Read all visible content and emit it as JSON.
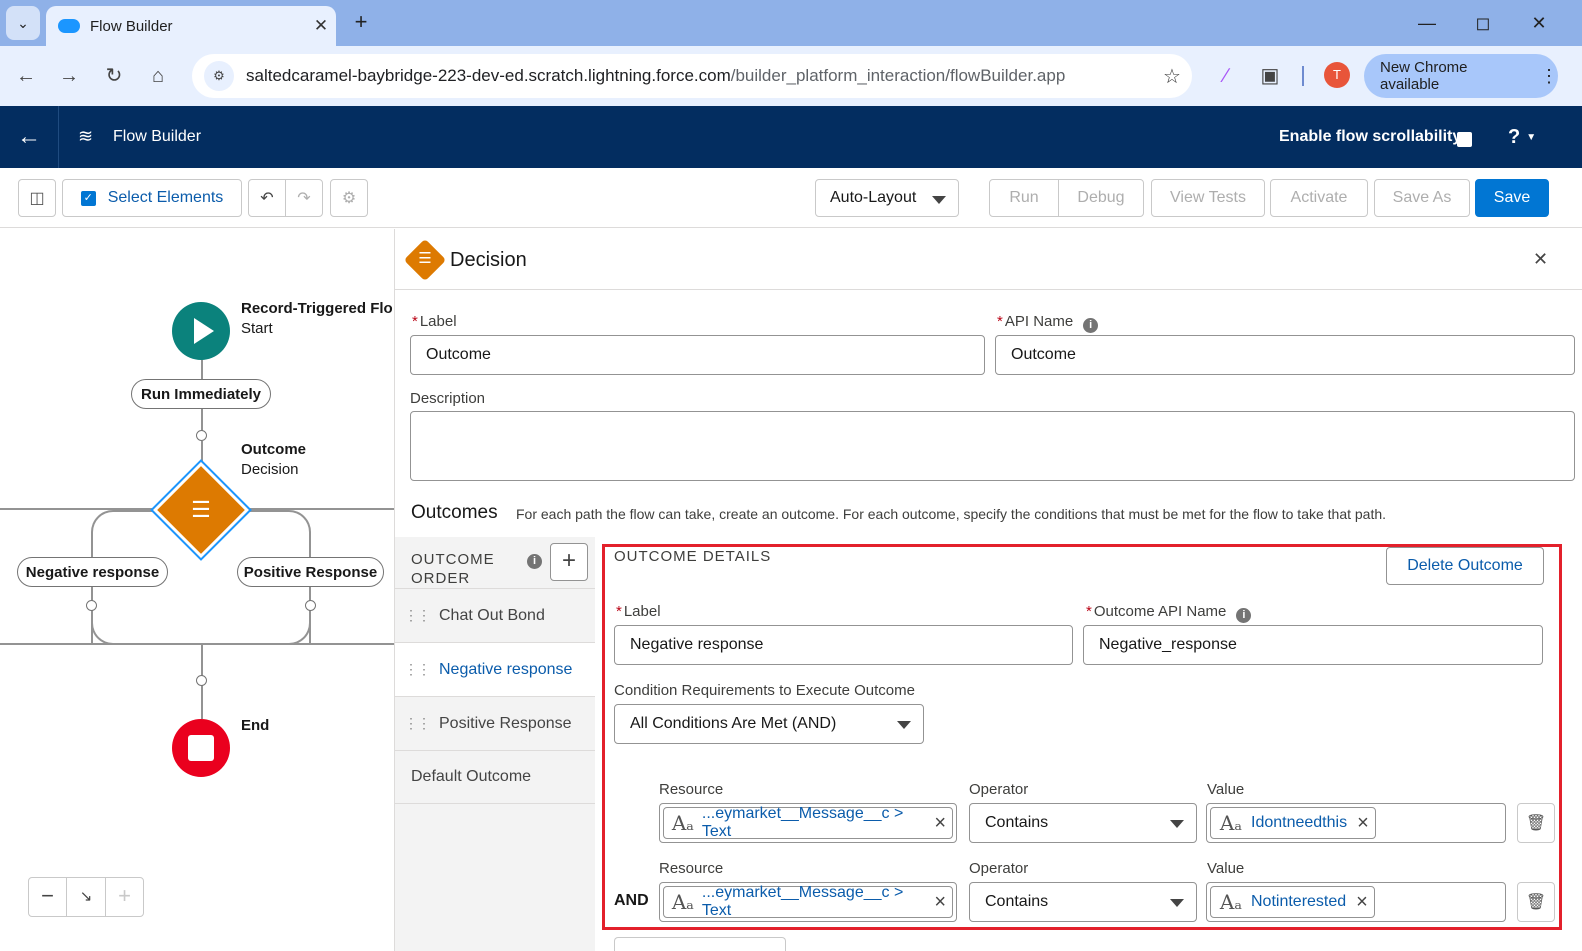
{
  "browser": {
    "tab_title": "Flow Builder",
    "url_host": "saltedcaramel-baybridge-223-dev-ed.scratch.lightning.force.com",
    "url_path": "/builder_platform_interaction/flowBuilder.app",
    "new_chrome": "New Chrome available",
    "avatar_letter": "T"
  },
  "header": {
    "app_title": "Flow Builder",
    "scroll_label": "Enable flow scrollability",
    "help": "?"
  },
  "toolbar": {
    "select_elements": "Select Elements",
    "layout": "Auto-Layout",
    "run": "Run",
    "debug": "Debug",
    "view_tests": "View Tests",
    "activate": "Activate",
    "save_as": "Save As",
    "save": "Save"
  },
  "canvas": {
    "start_title": "Record-Triggered Flo",
    "start_sub": "Start",
    "run_immediately": "Run Immediately",
    "decision_title": "Outcome",
    "decision_sub": "Decision",
    "branch_left": "Negative response",
    "branch_right": "Positive Response",
    "end_title": "End"
  },
  "panel": {
    "title": "Decision",
    "label_label": "Label",
    "label_value": "Outcome",
    "api_label": "API Name",
    "api_value": "Outcome",
    "description_label": "Description",
    "outcomes_title": "Outcomes",
    "outcomes_help": "For each path the flow can take, create an outcome. For each outcome, specify the conditions that must be met for the flow to take that path.",
    "order_title_1": "OUTCOME",
    "order_title_2": "ORDER",
    "order_items": [
      "Chat Out Bond",
      "Negative response",
      "Positive Response",
      "Default Outcome"
    ],
    "details_title": "OUTCOME DETAILS",
    "delete_outcome": "Delete Outcome",
    "d_label_label": "Label",
    "d_label_value": "Negative response",
    "d_api_label": "Outcome API Name",
    "d_api_value": "Negative_response",
    "cond_req_label": "Condition Requirements to Execute Outcome",
    "cond_req_value": "All Conditions Are Met (AND)",
    "conditions": [
      {
        "resource_label": "Resource",
        "resource": "...eymarket__Message__c > Text",
        "operator_label": "Operator",
        "operator": "Contains",
        "value_label": "Value",
        "value": "Idontneedthis",
        "prefix": ""
      },
      {
        "resource_label": "Resource",
        "resource": "...eymarket__Message__c > Text",
        "operator_label": "Operator",
        "operator": "Contains",
        "value_label": "Value",
        "value": "Notinterested",
        "prefix": "AND"
      }
    ]
  },
  "colors": {
    "sf_header": "#032d60",
    "brand_blue": "#0176d3",
    "decision_orange": "#dd7a01",
    "start_teal": "#0b827c",
    "end_red": "#ea001e",
    "highlight_red": "#e3202b"
  }
}
